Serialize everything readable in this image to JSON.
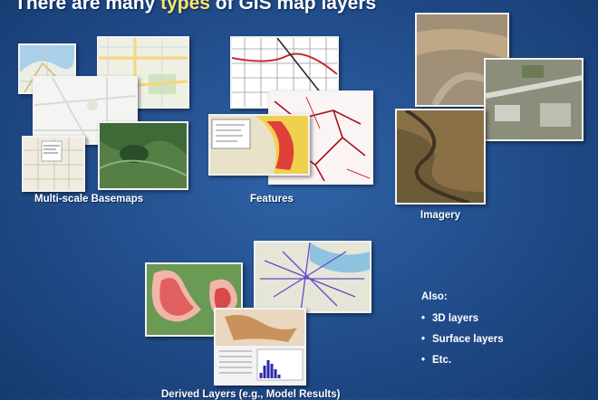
{
  "slide": {
    "title_pre": "There are many ",
    "title_highlight": "types",
    "title_post": " of GIS map layers",
    "highlight_color": "#ffe76a"
  },
  "groups": {
    "basemaps_label": "Multi-scale Basemaps",
    "features_label": "Features",
    "imagery_label": "Imagery",
    "derived_label": "Derived Layers (e.g., Model Results)"
  },
  "also": {
    "heading": "Also:",
    "bullet_glyph": "•",
    "items": [
      "3D layers",
      "Surface layers",
      "Etc."
    ]
  }
}
